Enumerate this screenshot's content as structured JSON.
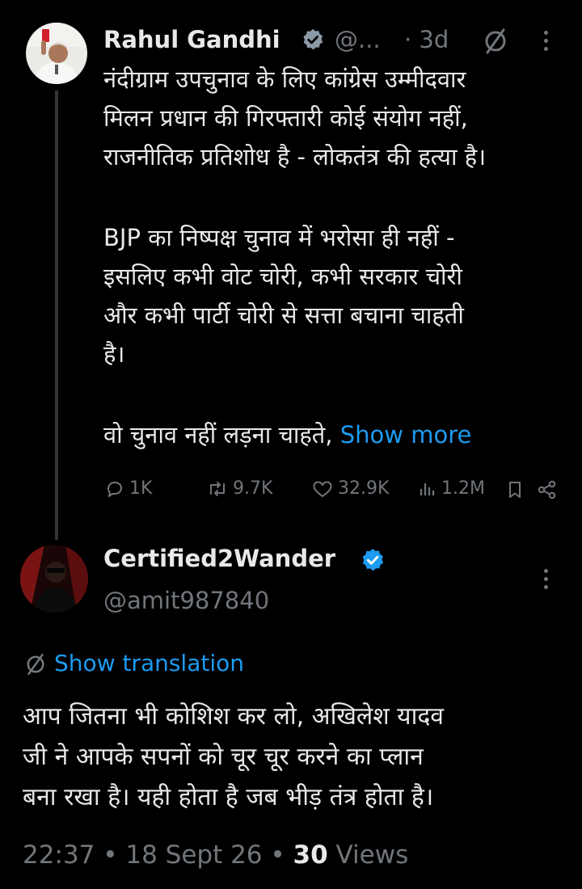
{
  "tweet": {
    "author": "Rahul Gandhi",
    "handle": "@...",
    "time": "· 3d",
    "body_p1": "नंदीग्राम उपचुनाव के लिए कांग्रेस उम्मीदवार\nमिलन प्रधान की गिरफ्तारी कोई संयोग नहीं,\nराजनीतिक प्रतिशोध है - लोकतंत्र की हत्या है।",
    "body_p2": "BJP का निष्पक्ष चुनाव में भरोसा ही नहीं -\nइसलिए कभी वोट चोरी, कभी सरकार चोरी\nऔर कभी पार्टी चोरी से सत्ता बचाना चाहती\nहै।",
    "body_p3": "वो चुनाव नहीं लड़ना चाहते, ",
    "show_more": "Show more",
    "stats": {
      "replies": "1K",
      "reposts": "9.7K",
      "likes": "32.9K",
      "views": "1.2M"
    }
  },
  "reply": {
    "author": "Certified2Wander",
    "handle": "@amit987840",
    "show_translation": "Show translation",
    "body": "आप जितना भी कोशिश कर लो, अखिलेश यादव\nजी ने आपके सपनों को चूर चूर करने का प्लान\nबना रखा है। यही होता है जब भीड़ तंत्र होता है।",
    "time": "22:37",
    "date": "18 Sept 26",
    "views_count": "30",
    "views_label": "Views"
  },
  "colors": {
    "background": "#000000",
    "text": "#e7e9ea",
    "muted": "#71767b",
    "accent": "#1d9bf0"
  },
  "icons": [
    "verified-badge-icon",
    "no-translate-icon",
    "more-icon",
    "reply-icon",
    "repost-icon",
    "like-icon",
    "views-icon",
    "bookmark-icon",
    "share-icon",
    "translate-icon"
  ]
}
